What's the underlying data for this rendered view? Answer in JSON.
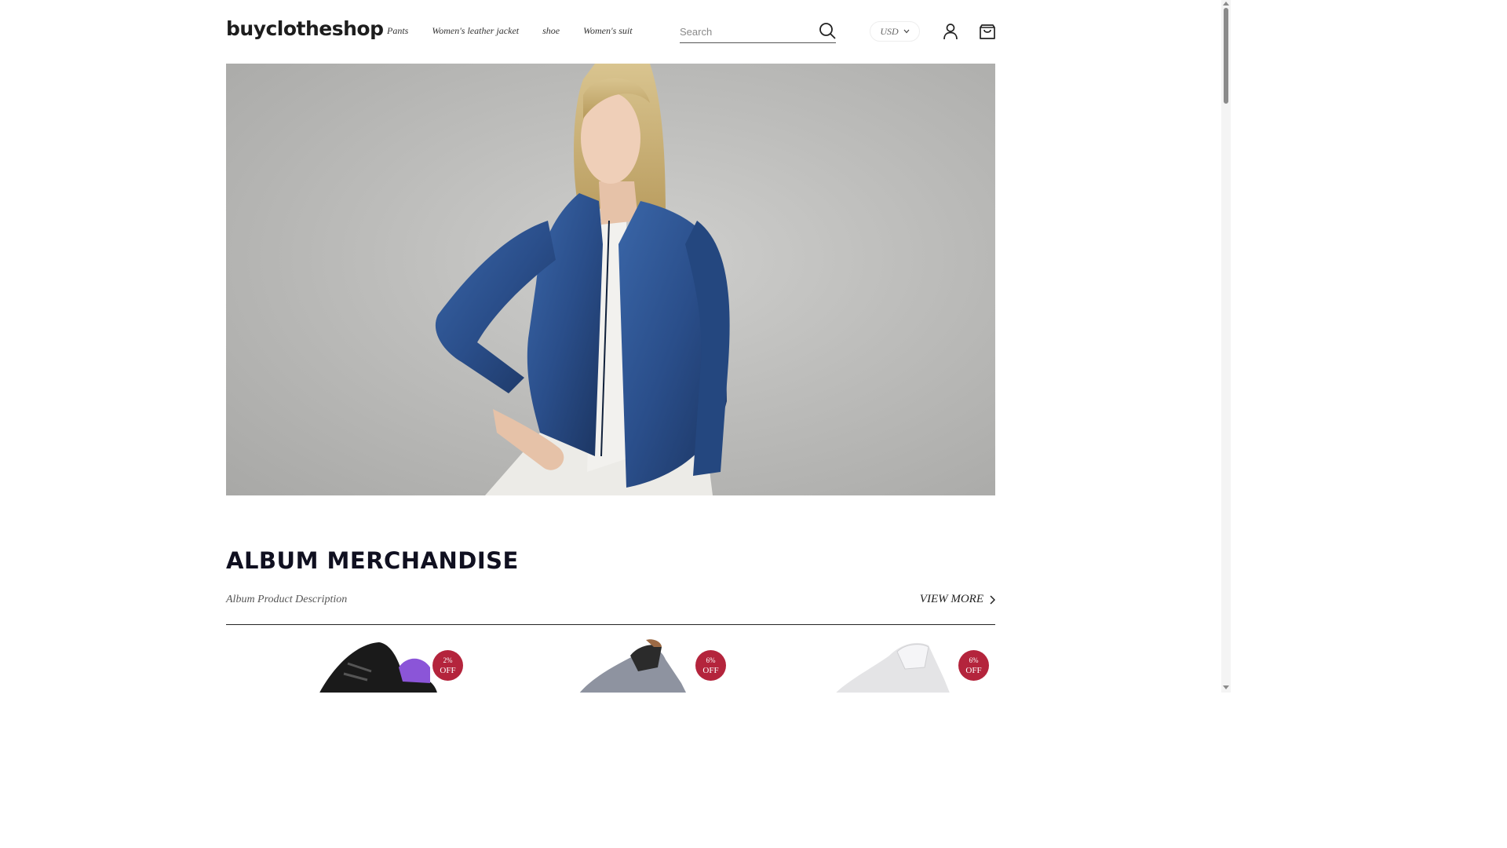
{
  "header": {
    "logo": "buyclotheshop",
    "nav": [
      "Pants",
      "Women's leather jacket",
      "shoe",
      "Women's suit"
    ],
    "search": {
      "placeholder": "Search",
      "value": ""
    },
    "currency": "USD",
    "icons": {
      "search": "search-icon",
      "account": "user-icon",
      "cart": "cart-icon",
      "currency_dropdown": "chevron-down-icon"
    }
  },
  "hero": {
    "image": "woman-in-blue-leather-jacket",
    "colors": {
      "background": "#bdbdbb",
      "jacket": "#2b4f8a"
    }
  },
  "section": {
    "title": "ALBUM MERCHANDISE",
    "description": "Album Product Description",
    "view_more": "VIEW MORE"
  },
  "products": [
    {
      "badge_percent": "2%",
      "badge_off": "OFF",
      "image": "black-purple-sneaker"
    },
    {
      "badge_percent": "6%",
      "badge_off": "OFF",
      "image": "grey-knit-sneaker"
    },
    {
      "badge_percent": "6%",
      "badge_off": "OFF",
      "image": "white-knit-sneaker"
    }
  ],
  "colors": {
    "badge": "#b4243c",
    "text": "#222222"
  }
}
